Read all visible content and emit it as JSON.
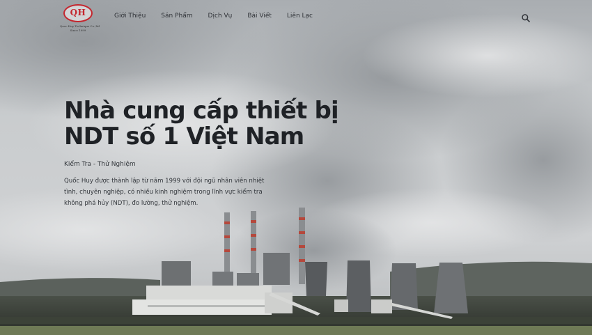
{
  "logo": {
    "mark": "QH",
    "line1": "Quoc Huy Technique Co.,ltd",
    "line2": "Since 1999"
  },
  "nav": {
    "items": [
      {
        "label": "Giới Thiệu"
      },
      {
        "label": "Sản Phẩm"
      },
      {
        "label": "Dịch Vụ"
      },
      {
        "label": "Bài Viết"
      },
      {
        "label": "Liên Lạc"
      }
    ]
  },
  "hero": {
    "title_line1": "Nhà cung cấp thiết bị",
    "title_line2": "NDT số 1 Việt Nam",
    "subtitle": "Kiểm Tra - Thử Nghiệm",
    "description": "Quốc Huy được thành lập từ năm 1999 với đội ngũ nhân viên nhiệt tình, chuyên nghiệp, có nhiều kinh nghiệm trong lĩnh vực kiểm tra không phá hủy (NDT), đo lường, thử nghiệm."
  },
  "icons": {
    "search": "search-icon"
  },
  "colors": {
    "brand_red": "#c4262e",
    "text_dark": "#1f2226",
    "sky": "#c4c7ca"
  }
}
